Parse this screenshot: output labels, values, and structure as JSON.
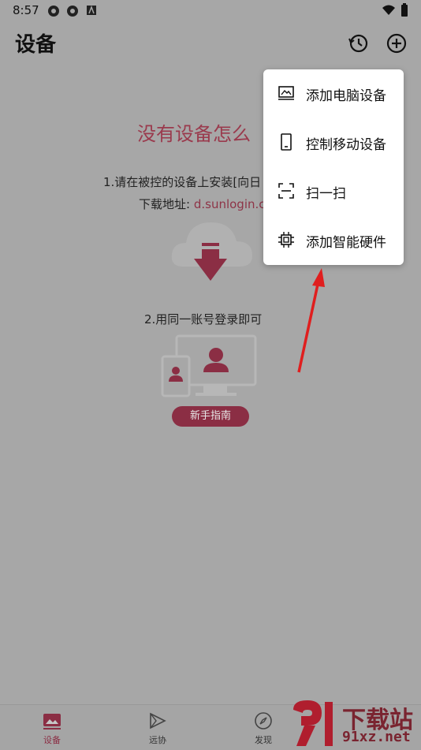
{
  "status_bar": {
    "time": "8:57"
  },
  "header": {
    "title": "设备"
  },
  "empty_state": {
    "title": "没有设备怎么",
    "step1": "1.请在被控的设备上安装[向日",
    "download_label": "下载地址:",
    "download_link": "d.sunlogin.c",
    "step2": "2.用同一账号登录即可",
    "guide_button": "新手指南"
  },
  "menu": {
    "items": [
      {
        "label": "添加电脑设备",
        "icon": "computer-icon"
      },
      {
        "label": "控制移动设备",
        "icon": "phone-icon"
      },
      {
        "label": "扫一扫",
        "icon": "scan-icon"
      },
      {
        "label": "添加智能硬件",
        "icon": "chip-icon"
      }
    ]
  },
  "bottom_nav": {
    "items": [
      {
        "label": "设备",
        "icon": "device-icon",
        "active": true
      },
      {
        "label": "远协",
        "icon": "remote-icon"
      },
      {
        "label": "发现",
        "icon": "compass-icon"
      }
    ]
  },
  "watermark": {
    "brand": "下载站",
    "site": "91xz.net"
  },
  "colors": {
    "accent": "#8b2e44",
    "overlay": "#a7a7a7",
    "annotation_arrow": "#e01e1e"
  }
}
